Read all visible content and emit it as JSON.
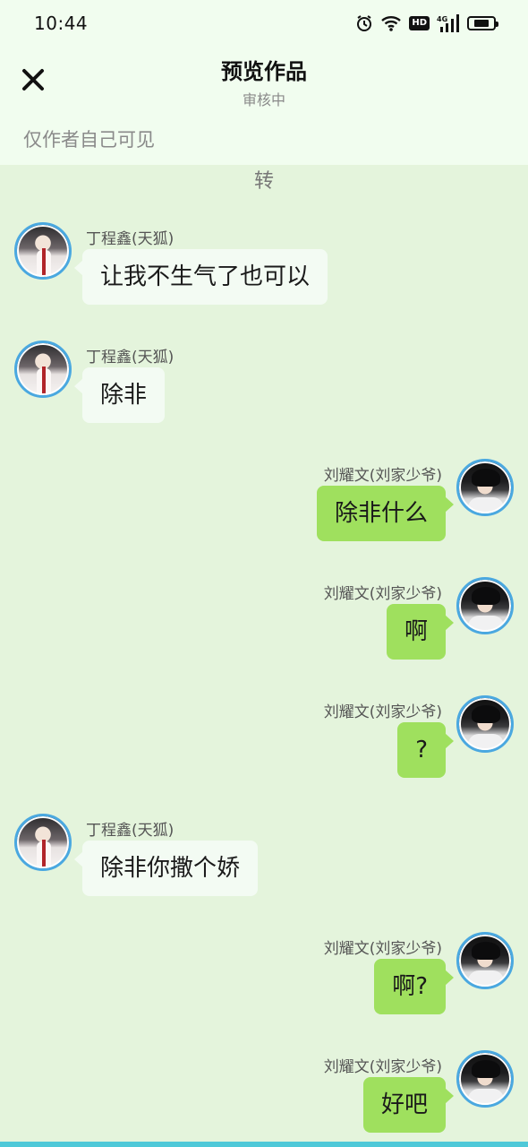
{
  "status_bar": {
    "time": "10:44",
    "icons": [
      "alarm-icon",
      "wifi-icon",
      "hd-icon",
      "signal-4g-icon",
      "battery-icon"
    ],
    "hd_label": "HD",
    "network_label": "4G",
    "battery_level": 0.7
  },
  "header": {
    "title": "预览作品",
    "subtitle": "审核中",
    "visibility": "仅作者自己可见",
    "close_icon": "close-icon"
  },
  "chat": {
    "previous_tail": "转",
    "messages": [
      {
        "side": "left",
        "sender": "丁程鑫(天狐)",
        "text": "让我不生气了也可以",
        "avatar": "avatar-a"
      },
      {
        "side": "left",
        "sender": "丁程鑫(天狐)",
        "text": "除非",
        "avatar": "avatar-a"
      },
      {
        "side": "right",
        "sender": "刘耀文(刘家少爷)",
        "text": "除非什么",
        "avatar": "avatar-b"
      },
      {
        "side": "right",
        "sender": "刘耀文(刘家少爷)",
        "text": "啊",
        "avatar": "avatar-b"
      },
      {
        "side": "right",
        "sender": "刘耀文(刘家少爷)",
        "text": "?",
        "avatar": "avatar-b"
      },
      {
        "side": "left",
        "sender": "丁程鑫(天狐)",
        "text": "除非你撒个娇",
        "avatar": "avatar-a"
      },
      {
        "side": "right",
        "sender": "刘耀文(刘家少爷)",
        "text": "啊?",
        "avatar": "avatar-b"
      },
      {
        "side": "right",
        "sender": "刘耀文(刘家少爷)",
        "text": "好吧",
        "avatar": "avatar-b"
      }
    ]
  },
  "colors": {
    "background": "#e4f4dc",
    "header_background": "#f1fdef",
    "left_bubble": "#f3fbf3",
    "right_bubble": "#9fe05e",
    "avatar_ring": "#4aa8e0",
    "bottom_accent": "#4fc9d8"
  }
}
